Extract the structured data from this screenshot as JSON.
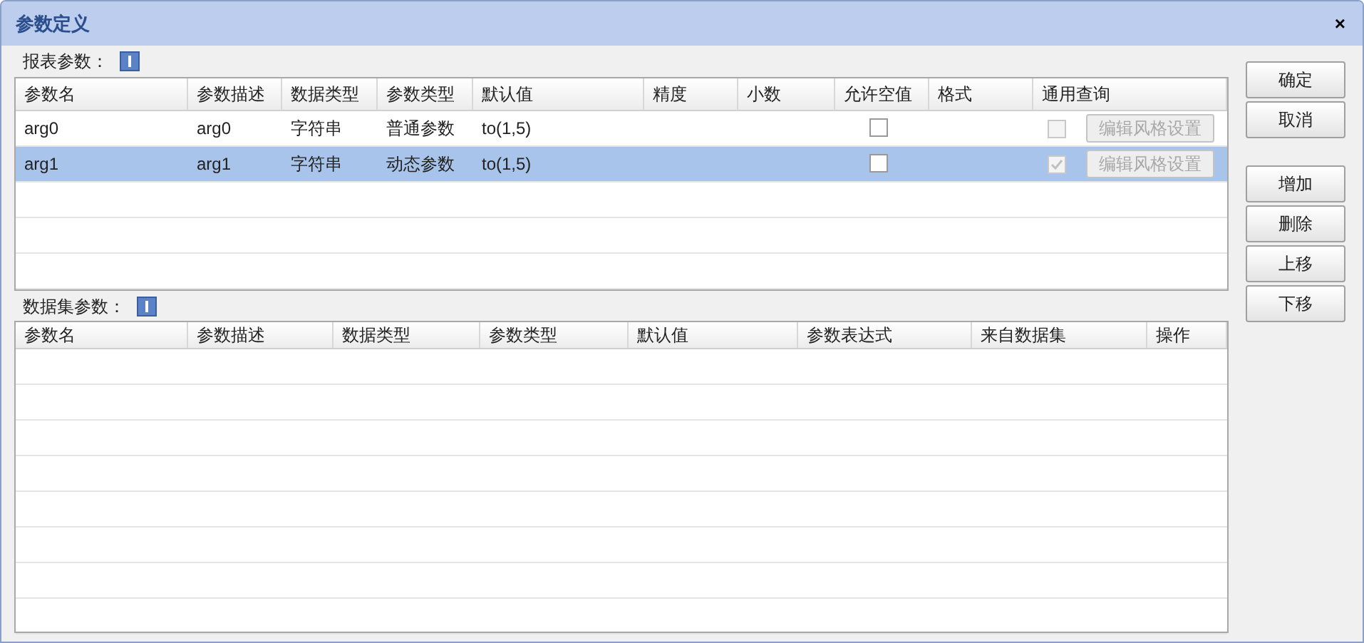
{
  "window": {
    "title": "参数定义",
    "close": "×"
  },
  "report_params": {
    "label": "报表参数：",
    "columns": [
      "参数名",
      "参数描述",
      "数据类型",
      "参数类型",
      "默认值",
      "精度",
      "小数",
      "允许空值",
      "格式",
      "通用查询"
    ],
    "rows": [
      {
        "cells": [
          "arg0",
          "arg0",
          "字符串",
          "普通参数",
          "to(1,5)"
        ],
        "selected": false,
        "allow_null": {
          "checked": false
        },
        "general_query": {
          "checked": false,
          "disabled": true
        },
        "edit_button": {
          "label": "编辑风格设置",
          "disabled": true
        }
      },
      {
        "cells": [
          "arg1",
          "arg1",
          "字符串",
          "动态参数",
          "to(1,5)"
        ],
        "selected": true,
        "allow_null": {
          "checked": false
        },
        "general_query": {
          "checked": true,
          "disabled": true
        },
        "edit_button": {
          "label": "编辑风格设置",
          "disabled": true
        }
      }
    ]
  },
  "dataset_params": {
    "label": "数据集参数：",
    "columns": [
      "参数名",
      "参数描述",
      "数据类型",
      "参数类型",
      "默认值",
      "参数表达式",
      "来自数据集",
      "操作"
    ]
  },
  "dialog_buttons": [
    "确定",
    "取消"
  ],
  "list_buttons": [
    "增加",
    "删除",
    "上移",
    "下移"
  ]
}
